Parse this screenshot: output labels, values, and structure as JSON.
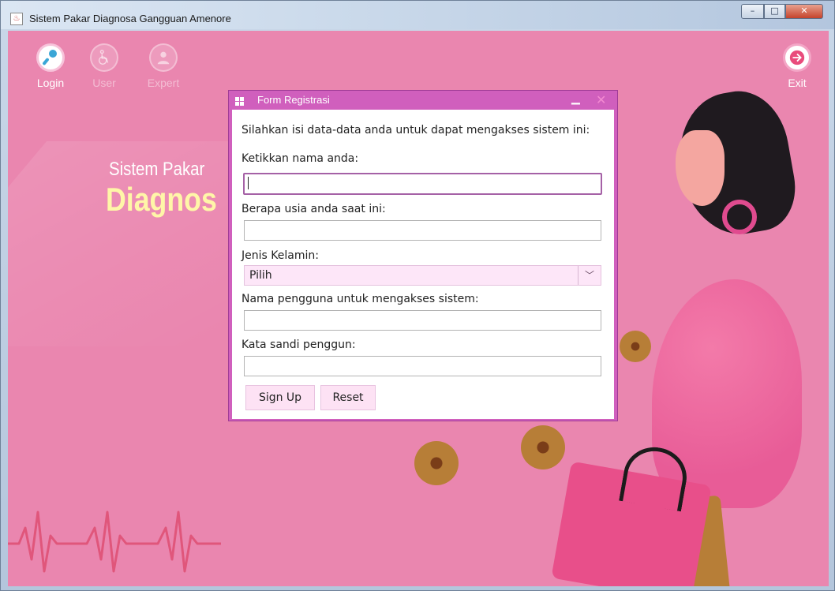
{
  "window": {
    "title": "Sistem Pakar Diagnosa Gangguan Amenore"
  },
  "nav": {
    "login": "Login",
    "user": "User",
    "expert": "Expert",
    "exit": "Exit"
  },
  "headline": {
    "small": "Sistem Pakar",
    "big": "Diagnos"
  },
  "dialog": {
    "title": "Form Registrasi",
    "intro": "Silahkan isi data-data anda untuk dapat mengakses sistem ini:",
    "name_label": "Ketikkan nama anda:",
    "name_value": "",
    "age_label": "Berapa usia anda saat ini:",
    "age_value": "",
    "gender_label": "Jenis Kelamin:",
    "gender_selected": "Pilih",
    "username_label": "Nama pengguna untuk mengakses sistem:",
    "username_value": "",
    "password_label": "Kata sandi penggun:",
    "password_value": "",
    "signup": "Sign Up",
    "reset": "Reset"
  },
  "colors": {
    "background": "#ea86af",
    "dialog_border": "#d05fbd",
    "headline_accent": "#fff6a8"
  }
}
